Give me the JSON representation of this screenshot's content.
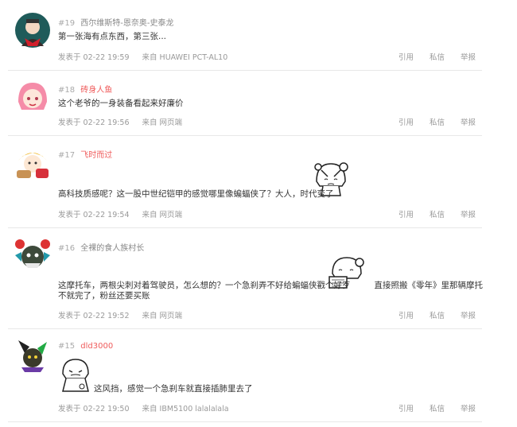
{
  "actions": {
    "quote": "引用",
    "message": "私信",
    "report": "举报"
  },
  "posts": [
    {
      "floor": "#19",
      "username": "西尔维斯特-恩奈奥-史泰龙",
      "content": "第一张海有点东西，第三张...",
      "time": "发表于 02-22 19:59",
      "source": "来自 HUAWEI PCT-AL10"
    },
    {
      "floor": "#18",
      "username": "砖身人鱼",
      "content": "这个老爷的一身装备看起来好廉价",
      "time": "发表于 02-22 19:56",
      "source": "来自 网页端"
    },
    {
      "floor": "#17",
      "username": "飞时而过",
      "content": "高科技质感呢？这一股中世纪铠甲的感觉哪里像蝙蝠侠了？大人，时代变了",
      "time": "发表于 02-22 19:54",
      "source": "来自 网页端"
    },
    {
      "floor": "#16",
      "username": "全裸的食人族村长",
      "content_line1": "这摩托车，两根尖刺对着驾驶员，怎么想的？一个急刹弄不好给蝙蝠侠戳个好歹",
      "content_line1b": "直接照搬《零年》里那辆摩托",
      "content_line2": "不就完了，粉丝还要买账",
      "time": "发表于 02-22 19:52",
      "source": "来自 网页端"
    },
    {
      "floor": "#15",
      "username": "dld3000",
      "content": "这风挡，感觉一个急刹车就直接插肺里去了",
      "time": "发表于 02-22 19:50",
      "source": "来自 IBM5100 lalalalala"
    }
  ]
}
